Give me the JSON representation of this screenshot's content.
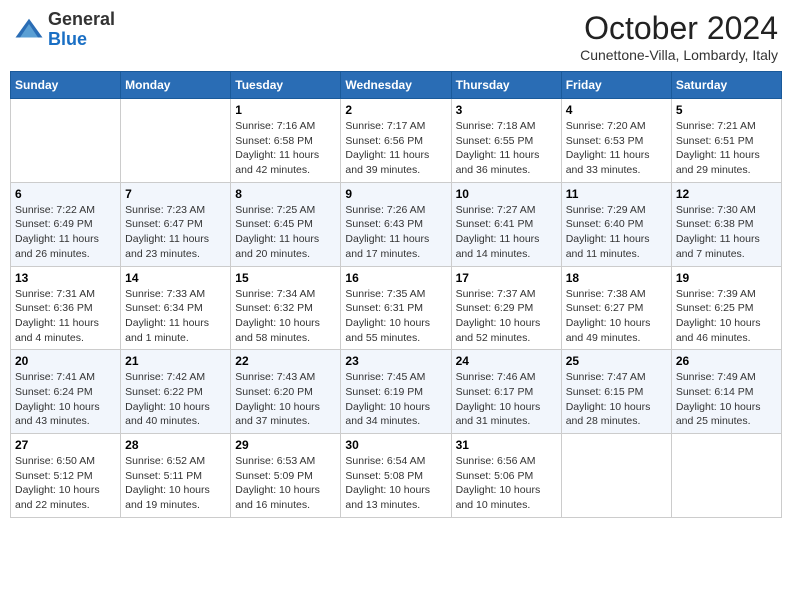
{
  "header": {
    "logo_general": "General",
    "logo_blue": "Blue",
    "month": "October 2024",
    "location": "Cunettone-Villa, Lombardy, Italy"
  },
  "weekdays": [
    "Sunday",
    "Monday",
    "Tuesday",
    "Wednesday",
    "Thursday",
    "Friday",
    "Saturday"
  ],
  "weeks": [
    [
      {
        "day": "",
        "sunrise": "",
        "sunset": "",
        "daylight": ""
      },
      {
        "day": "",
        "sunrise": "",
        "sunset": "",
        "daylight": ""
      },
      {
        "day": "1",
        "sunrise": "Sunrise: 7:16 AM",
        "sunset": "Sunset: 6:58 PM",
        "daylight": "Daylight: 11 hours and 42 minutes."
      },
      {
        "day": "2",
        "sunrise": "Sunrise: 7:17 AM",
        "sunset": "Sunset: 6:56 PM",
        "daylight": "Daylight: 11 hours and 39 minutes."
      },
      {
        "day": "3",
        "sunrise": "Sunrise: 7:18 AM",
        "sunset": "Sunset: 6:55 PM",
        "daylight": "Daylight: 11 hours and 36 minutes."
      },
      {
        "day": "4",
        "sunrise": "Sunrise: 7:20 AM",
        "sunset": "Sunset: 6:53 PM",
        "daylight": "Daylight: 11 hours and 33 minutes."
      },
      {
        "day": "5",
        "sunrise": "Sunrise: 7:21 AM",
        "sunset": "Sunset: 6:51 PM",
        "daylight": "Daylight: 11 hours and 29 minutes."
      }
    ],
    [
      {
        "day": "6",
        "sunrise": "Sunrise: 7:22 AM",
        "sunset": "Sunset: 6:49 PM",
        "daylight": "Daylight: 11 hours and 26 minutes."
      },
      {
        "day": "7",
        "sunrise": "Sunrise: 7:23 AM",
        "sunset": "Sunset: 6:47 PM",
        "daylight": "Daylight: 11 hours and 23 minutes."
      },
      {
        "day": "8",
        "sunrise": "Sunrise: 7:25 AM",
        "sunset": "Sunset: 6:45 PM",
        "daylight": "Daylight: 11 hours and 20 minutes."
      },
      {
        "day": "9",
        "sunrise": "Sunrise: 7:26 AM",
        "sunset": "Sunset: 6:43 PM",
        "daylight": "Daylight: 11 hours and 17 minutes."
      },
      {
        "day": "10",
        "sunrise": "Sunrise: 7:27 AM",
        "sunset": "Sunset: 6:41 PM",
        "daylight": "Daylight: 11 hours and 14 minutes."
      },
      {
        "day": "11",
        "sunrise": "Sunrise: 7:29 AM",
        "sunset": "Sunset: 6:40 PM",
        "daylight": "Daylight: 11 hours and 11 minutes."
      },
      {
        "day": "12",
        "sunrise": "Sunrise: 7:30 AM",
        "sunset": "Sunset: 6:38 PM",
        "daylight": "Daylight: 11 hours and 7 minutes."
      }
    ],
    [
      {
        "day": "13",
        "sunrise": "Sunrise: 7:31 AM",
        "sunset": "Sunset: 6:36 PM",
        "daylight": "Daylight: 11 hours and 4 minutes."
      },
      {
        "day": "14",
        "sunrise": "Sunrise: 7:33 AM",
        "sunset": "Sunset: 6:34 PM",
        "daylight": "Daylight: 11 hours and 1 minute."
      },
      {
        "day": "15",
        "sunrise": "Sunrise: 7:34 AM",
        "sunset": "Sunset: 6:32 PM",
        "daylight": "Daylight: 10 hours and 58 minutes."
      },
      {
        "day": "16",
        "sunrise": "Sunrise: 7:35 AM",
        "sunset": "Sunset: 6:31 PM",
        "daylight": "Daylight: 10 hours and 55 minutes."
      },
      {
        "day": "17",
        "sunrise": "Sunrise: 7:37 AM",
        "sunset": "Sunset: 6:29 PM",
        "daylight": "Daylight: 10 hours and 52 minutes."
      },
      {
        "day": "18",
        "sunrise": "Sunrise: 7:38 AM",
        "sunset": "Sunset: 6:27 PM",
        "daylight": "Daylight: 10 hours and 49 minutes."
      },
      {
        "day": "19",
        "sunrise": "Sunrise: 7:39 AM",
        "sunset": "Sunset: 6:25 PM",
        "daylight": "Daylight: 10 hours and 46 minutes."
      }
    ],
    [
      {
        "day": "20",
        "sunrise": "Sunrise: 7:41 AM",
        "sunset": "Sunset: 6:24 PM",
        "daylight": "Daylight: 10 hours and 43 minutes."
      },
      {
        "day": "21",
        "sunrise": "Sunrise: 7:42 AM",
        "sunset": "Sunset: 6:22 PM",
        "daylight": "Daylight: 10 hours and 40 minutes."
      },
      {
        "day": "22",
        "sunrise": "Sunrise: 7:43 AM",
        "sunset": "Sunset: 6:20 PM",
        "daylight": "Daylight: 10 hours and 37 minutes."
      },
      {
        "day": "23",
        "sunrise": "Sunrise: 7:45 AM",
        "sunset": "Sunset: 6:19 PM",
        "daylight": "Daylight: 10 hours and 34 minutes."
      },
      {
        "day": "24",
        "sunrise": "Sunrise: 7:46 AM",
        "sunset": "Sunset: 6:17 PM",
        "daylight": "Daylight: 10 hours and 31 minutes."
      },
      {
        "day": "25",
        "sunrise": "Sunrise: 7:47 AM",
        "sunset": "Sunset: 6:15 PM",
        "daylight": "Daylight: 10 hours and 28 minutes."
      },
      {
        "day": "26",
        "sunrise": "Sunrise: 7:49 AM",
        "sunset": "Sunset: 6:14 PM",
        "daylight": "Daylight: 10 hours and 25 minutes."
      }
    ],
    [
      {
        "day": "27",
        "sunrise": "Sunrise: 6:50 AM",
        "sunset": "Sunset: 5:12 PM",
        "daylight": "Daylight: 10 hours and 22 minutes."
      },
      {
        "day": "28",
        "sunrise": "Sunrise: 6:52 AM",
        "sunset": "Sunset: 5:11 PM",
        "daylight": "Daylight: 10 hours and 19 minutes."
      },
      {
        "day": "29",
        "sunrise": "Sunrise: 6:53 AM",
        "sunset": "Sunset: 5:09 PM",
        "daylight": "Daylight: 10 hours and 16 minutes."
      },
      {
        "day": "30",
        "sunrise": "Sunrise: 6:54 AM",
        "sunset": "Sunset: 5:08 PM",
        "daylight": "Daylight: 10 hours and 13 minutes."
      },
      {
        "day": "31",
        "sunrise": "Sunrise: 6:56 AM",
        "sunset": "Sunset: 5:06 PM",
        "daylight": "Daylight: 10 hours and 10 minutes."
      },
      {
        "day": "",
        "sunrise": "",
        "sunset": "",
        "daylight": ""
      },
      {
        "day": "",
        "sunrise": "",
        "sunset": "",
        "daylight": ""
      }
    ]
  ]
}
